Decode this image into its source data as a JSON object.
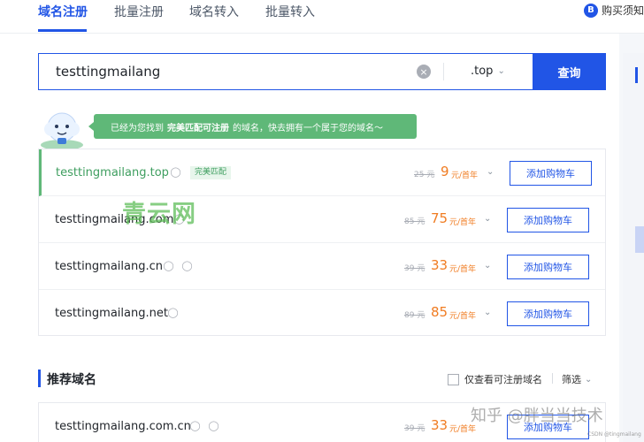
{
  "tabs": [
    {
      "label": "域名注册",
      "active": true
    },
    {
      "label": "批量注册",
      "active": false
    },
    {
      "label": "域名转入",
      "active": false
    },
    {
      "label": "批量转入",
      "active": false
    }
  ],
  "help": {
    "icon_letter": "B",
    "label": "购买须知"
  },
  "search": {
    "value": "testtingmailang",
    "suffix": ".top",
    "button": "查询",
    "clear_icon": "×"
  },
  "notice": {
    "before": "已经为您找到",
    "highlight": "完美匹配可注册",
    "after": "的域名，快去拥有一个属于您的域名～"
  },
  "results": [
    {
      "domain": "testtingmailang.top",
      "tag": "完美匹配",
      "orig": "25 元",
      "price": "9",
      "unit": "元/首年",
      "cart": "添加购物车"
    },
    {
      "domain": "testtingmailang.com",
      "orig": "85 元",
      "price": "75",
      "unit": "元/首年",
      "cart": "添加购物车"
    },
    {
      "domain": "testtingmailang.cn",
      "orig": "39 元",
      "price": "33",
      "unit": "元/首年",
      "cart": "添加购物车"
    },
    {
      "domain": "testtingmailang.net",
      "orig": "89 元",
      "price": "85",
      "unit": "元/首年",
      "cart": "添加购物车"
    }
  ],
  "recommend": {
    "title": "推荐域名",
    "only_available": "仅查看可注册域名",
    "filter": "筛选",
    "row": {
      "domain": "testtingmailang.com.cn",
      "orig": "39 元",
      "price": "33",
      "unit": "元/首年",
      "cart": "添加购物车"
    }
  },
  "watermarks": {
    "center": "青云网",
    "bottom": "知乎 @胖当当技术",
    "tiny": "CSDN @tingmailang"
  },
  "icons": {
    "shield": "shield-icon",
    "info": "info-shield-icon",
    "chevron": "chevron-down-icon",
    "mascot": "cloud-mascot-icon"
  },
  "colors": {
    "primary": "#2155e6",
    "success": "#5fb878",
    "price": "#f07c22"
  }
}
